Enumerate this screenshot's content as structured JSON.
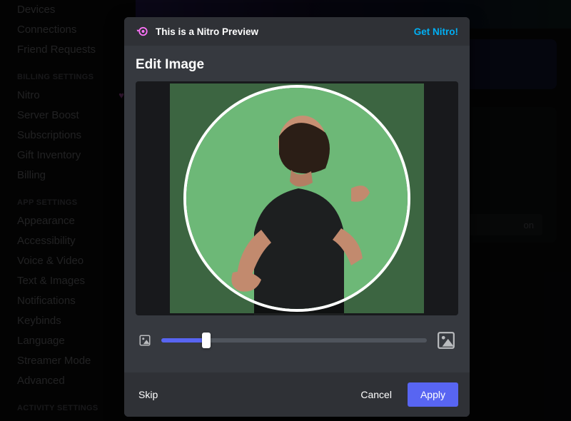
{
  "sidebar": {
    "top_items": [
      "Devices",
      "Connections",
      "Friend Requests"
    ],
    "billing_header": "BILLING SETTINGS",
    "billing_items": [
      "Nitro",
      "Server Boost",
      "Subscriptions",
      "Gift Inventory",
      "Billing"
    ],
    "nitro_badge": "♥",
    "app_header": "APP SETTINGS",
    "app_items": [
      "Appearance",
      "Accessibility",
      "Voice & Video",
      "Text & Images",
      "Notifications",
      "Keybinds",
      "Language",
      "Streamer Mode",
      "Advanced"
    ],
    "activity_header": "ACTIVITY SETTINGS"
  },
  "bg": {
    "button_fragment": "on"
  },
  "modal": {
    "banner_text": "This is a Nitro Preview",
    "get_nitro": "Get Nitro!",
    "title": "Edit Image",
    "slider": {
      "min": 0,
      "max": 100,
      "value": 17
    },
    "icons": {
      "small": "image-small-icon",
      "large": "image-large-icon",
      "nitro": "nitro-icon"
    }
  },
  "footer": {
    "skip": "Skip",
    "cancel": "Cancel",
    "apply": "Apply"
  },
  "colors": {
    "accent": "#5865f2",
    "nitro_pink": "#ff73fa",
    "link": "#00aff4",
    "crop_bg": "#6db877"
  }
}
